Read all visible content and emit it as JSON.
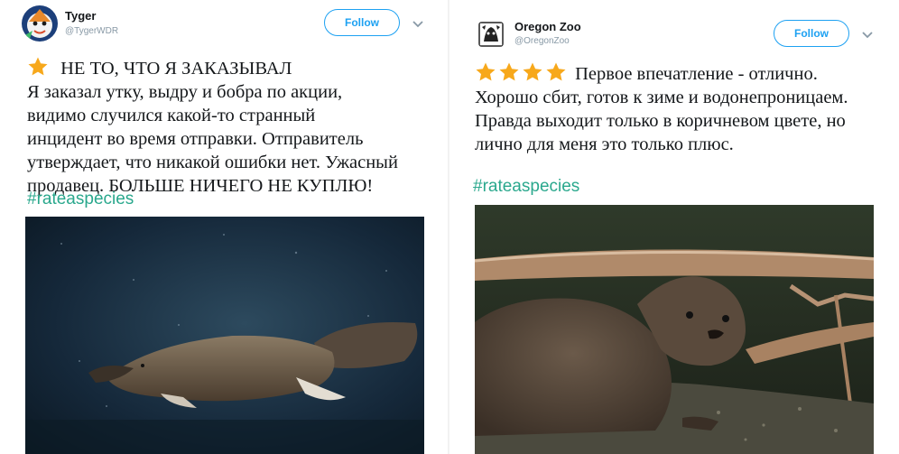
{
  "left_tweet": {
    "author_name": "Tyger",
    "author_handle": "@TygerWDR",
    "follow_label": "Follow",
    "rating_stars": 1,
    "title": "НЕ ТО, ЧТО Я ЗАКАЗЫВАЛ",
    "lines": [
      "Я заказал утку, выдру и бобра по акции,",
      "видимо случился какой-то странный",
      "инцидент во время отправки. Отправитель",
      "утверждает, что никакой ошибки нет. Ужасный",
      "продавец. БОЛЬШЕ НИЧЕГО НЕ КУПЛЮ!"
    ],
    "hashtag": "#rateaspecies",
    "image": "platypus-photo"
  },
  "right_tweet": {
    "author_name": "Oregon Zoo",
    "author_handle": "@OregonZoo",
    "follow_label": "Follow",
    "rating_stars": 4,
    "first_line": "Первое впечатление - отлично.",
    "lines": [
      "Хорошо сбит, готов к зиме и водонепроницаем.",
      "Правда выходит только в коричневом цвете, но",
      "лично для меня это только плюс."
    ],
    "hashtag": "#rateaspecies",
    "image": "otter-photo"
  },
  "colors": {
    "star": "#f7a81b",
    "link": "#1da1f2",
    "hashtag": "#2aa88d"
  }
}
